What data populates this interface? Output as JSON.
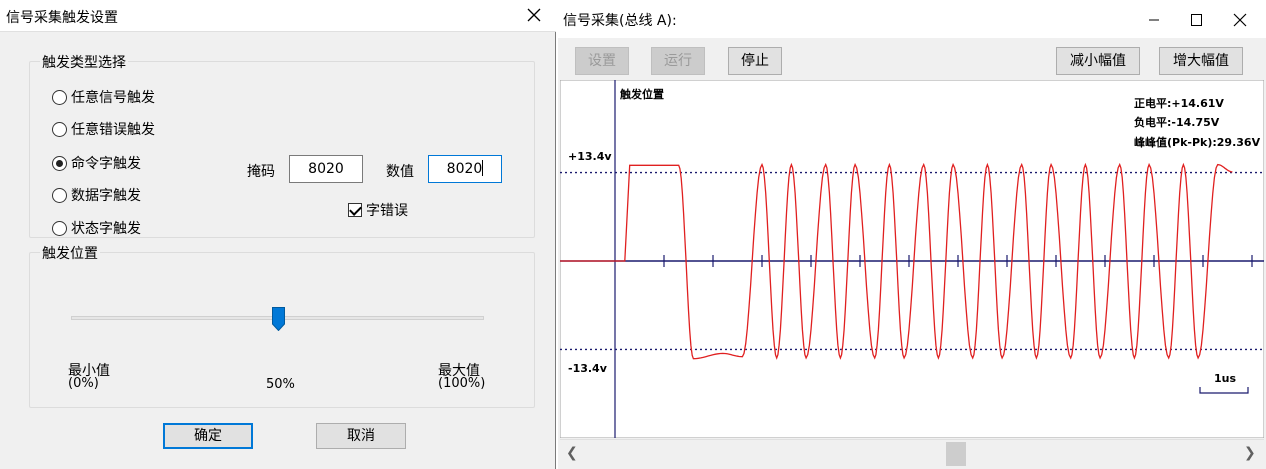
{
  "dialog": {
    "title": "信号采集触发设置",
    "trigger_type_group": {
      "label": "触发类型选择",
      "options": [
        {
          "label": "任意信号触发",
          "checked": false
        },
        {
          "label": "任意错误触发",
          "checked": false
        },
        {
          "label": "命令字触发",
          "checked": true
        },
        {
          "label": "数据字触发",
          "checked": false
        },
        {
          "label": "状态字触发",
          "checked": false
        }
      ],
      "mask_label": "掩码",
      "mask_value": "8020",
      "value_label": "数值",
      "value_value": "8020",
      "word_error_label": "字错误",
      "word_error_checked": true
    },
    "trigger_position_group": {
      "label": "触发位置",
      "min_label": "最小值",
      "min_pct": "(0%)",
      "max_label": "最大值",
      "max_pct": "(100%)",
      "current_pct": "50%",
      "slider_value": 0.5
    },
    "ok_label": "确定",
    "cancel_label": "取消"
  },
  "scope": {
    "title": "信号采集(总线 A):",
    "buttons": {
      "setup": "设置",
      "run": "运行",
      "stop": "停止",
      "decrease_amplitude": "减小幅值",
      "increase_amplitude": "增大幅值"
    },
    "trigger_label": "触发位置",
    "upper_level_label": "+13.4v",
    "lower_level_label": "-13.4v",
    "stats": {
      "positive": "正电平:+14.61V",
      "negative": "负电平:-14.75V",
      "peak_to_peak": "峰峰值(Pk-Pk):29.36V"
    },
    "time_scale_label": "1us"
  },
  "chart_data": {
    "type": "line",
    "title": "",
    "xlabel": "",
    "ylabel": "",
    "reference_lines": [
      13.4,
      -13.4
    ],
    "ylim": [
      -20,
      20
    ],
    "series": [
      {
        "color": "#e02020",
        "x": [
          0,
          0.2,
          0.3,
          0.4,
          1.3,
          1.6,
          2.2,
          2.6,
          3.0,
          3.3,
          3.6,
          3.9,
          4.3,
          4.6,
          4.9,
          5.3,
          5.6,
          5.9,
          6.3,
          6.6,
          6.9,
          7.3,
          7.6,
          7.9,
          8.3,
          8.6,
          8.9,
          9.3,
          9.6,
          9.9,
          10.3,
          10.6,
          10.9,
          11.3,
          11.6,
          11.9,
          12.3,
          12.6
        ],
        "y": [
          0,
          0,
          14.5,
          14.5,
          14.5,
          -14.8,
          -14.0,
          -14.5,
          14.6,
          -14.7,
          14.6,
          -14.7,
          14.6,
          -14.7,
          14.6,
          -14.7,
          14.6,
          -14.7,
          14.6,
          -14.7,
          14.6,
          -14.7,
          14.6,
          -14.7,
          14.6,
          -14.7,
          14.6,
          -14.7,
          14.6,
          -14.7,
          14.6,
          -14.7,
          14.6,
          -14.7,
          14.6,
          -14.7,
          14.6,
          13.5
        ]
      }
    ],
    "colors": {
      "signal": "#e02020",
      "axis": "#1a1a6e",
      "reference": "#1a1a6e"
    }
  }
}
